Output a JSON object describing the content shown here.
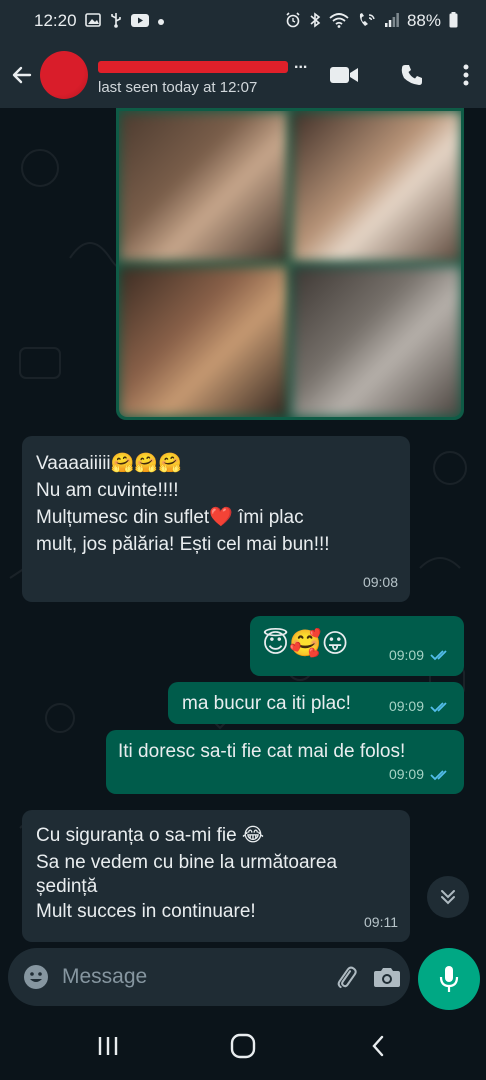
{
  "status_bar": {
    "time": "12:20",
    "battery": "88%",
    "left_icons": [
      "gallery-icon",
      "usb-icon",
      "youtube-icon",
      "dot-icon"
    ],
    "right_icons": [
      "alarm-icon",
      "bluetooth-icon",
      "wifi-icon",
      "wifi-call-icon",
      "signal-icon",
      "battery-icon"
    ]
  },
  "header": {
    "contact_name": "...",
    "last_seen": "last seen today at 12:07",
    "actions": [
      "video-call-icon",
      "phone-icon",
      "menu-icon"
    ]
  },
  "messages": [
    {
      "direction": "incoming",
      "lines": [
        "Vaaaaiiiii🤗🤗🤗",
        "Nu am cuvinte!!!!",
        "Mulțumesc din suflet❤️ îmi plac",
        "mult, jos pălăria! Ești cel mai bun!!!"
      ],
      "time": "09:08"
    },
    {
      "direction": "outgoing",
      "lines": [
        "😇🥰😛"
      ],
      "time": "09:09",
      "read": true
    },
    {
      "direction": "outgoing",
      "lines": [
        "ma bucur ca iti plac!"
      ],
      "time": "09:09",
      "read": true
    },
    {
      "direction": "outgoing",
      "lines": [
        "Iti doresc sa-ti fie cat mai de folos!"
      ],
      "time": "09:09",
      "read": true
    },
    {
      "direction": "incoming",
      "lines": [
        "Cu siguranța o sa-mi fie 😂",
        "Sa ne vedem cu bine la următoarea",
        "ședință",
        "Mult succes in continuare!"
      ],
      "time": "09:11"
    }
  ],
  "input": {
    "placeholder": "Message",
    "value": ""
  },
  "colors": {
    "background": "#0b141a",
    "bar": "#1f2c34",
    "incoming_bubble": "#1f2c34",
    "outgoing_bubble": "#005c4b",
    "accent": "#00a884",
    "read_ticks": "#53bdeb"
  }
}
